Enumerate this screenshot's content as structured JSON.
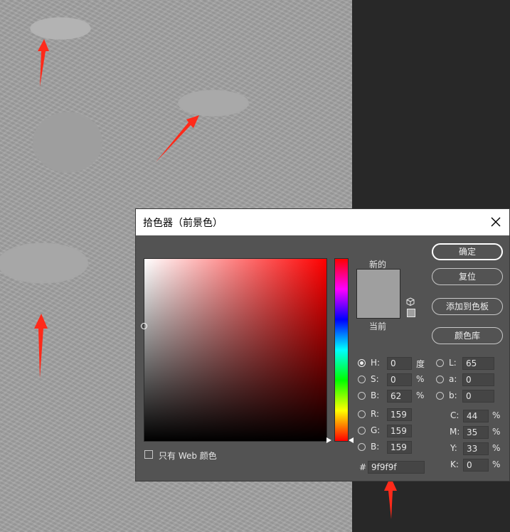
{
  "dialog": {
    "title": "拾色器（前景色）",
    "close_icon": "close-icon",
    "new_label": "新的",
    "current_label": "当前",
    "swatch_color": "#9f9f9f",
    "buttons": {
      "ok": "确定",
      "reset": "复位",
      "add_to_swatches": "添加到色板",
      "color_libraries": "颜色库"
    },
    "web_only_label": "只有 Web 颜色",
    "hsb": {
      "h_label": "H:",
      "h_value": "0",
      "h_unit": "度",
      "s_label": "S:",
      "s_value": "0",
      "s_unit": "%",
      "b_label": "B:",
      "b_value": "62",
      "b_unit": "%"
    },
    "lab": {
      "l_label": "L:",
      "l_value": "65",
      "a_label": "a:",
      "a_value": "0",
      "b_label": "b:",
      "b_value": "0"
    },
    "rgb": {
      "r_label": "R:",
      "r_value": "159",
      "g_label": "G:",
      "g_value": "159",
      "b_label": "B:",
      "b_value": "159"
    },
    "cmyk": {
      "c_label": "C:",
      "c_value": "44",
      "c_unit": "%",
      "m_label": "M:",
      "m_value": "35",
      "m_unit": "%",
      "y_label": "Y:",
      "y_value": "33",
      "y_unit": "%",
      "k_label": "K:",
      "k_value": "0",
      "k_unit": "%"
    },
    "hex_label": "#",
    "hex_value": "9f9f9f",
    "selected_mode": "H"
  },
  "colors": {
    "annotation_arrow": "#ff2a1a",
    "dialog_bg": "#535353"
  }
}
